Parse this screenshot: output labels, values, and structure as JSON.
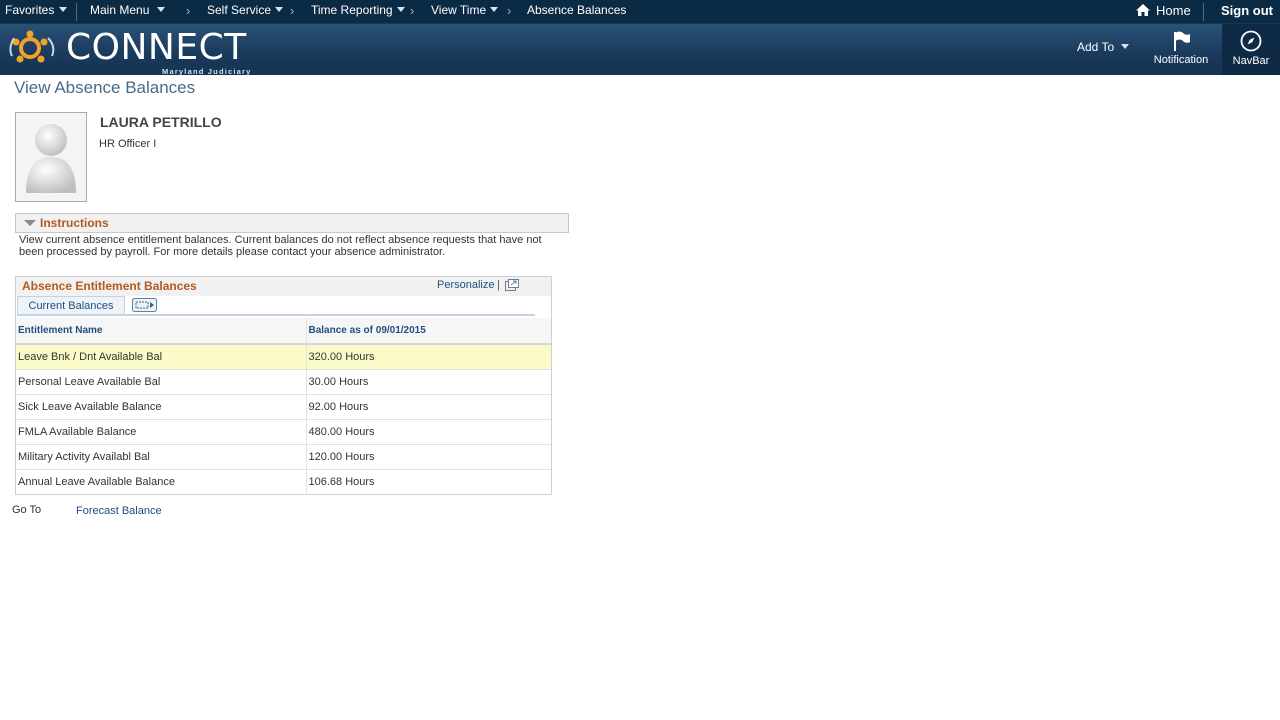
{
  "topnav": {
    "favorites": "Favorites",
    "main_menu": "Main Menu",
    "breadcrumbs": [
      "Self Service",
      "Time Reporting",
      "View Time",
      "Absence Balances"
    ],
    "home": "Home",
    "sign_out": "Sign out"
  },
  "banner": {
    "logo_text": "CONNECT",
    "logo_sub": "Maryland Judiciary",
    "add_to": "Add To",
    "notification": "Notification",
    "navbar": "NavBar"
  },
  "page": {
    "title": "View Absence Balances",
    "employee_name": "LAURA PETRILLO",
    "employee_title": "HR Officer I"
  },
  "instructions": {
    "label": "Instructions",
    "text": "View current absence entitlement balances. Current balances do not reflect absence requests that have not been processed by payroll. For more details please contact your absence administrator."
  },
  "grid": {
    "title": "Absence Entitlement Balances",
    "personalize": "Personalize",
    "pipe": "|",
    "tab_label": "Current Balances",
    "columns": [
      "Entitlement Name",
      "Balance as of 09/01/2015"
    ],
    "rows": [
      [
        "Leave Bnk / Dnt Available Bal",
        "320.00 Hours"
      ],
      [
        "Personal Leave Available Bal",
        "30.00 Hours"
      ],
      [
        "Sick Leave Available Balance",
        "92.00 Hours"
      ],
      [
        "FMLA Available Balance",
        "480.00 Hours"
      ],
      [
        "Military Activity Availabl Bal",
        "120.00 Hours"
      ],
      [
        "Annual Leave Available Balance",
        "106.68 Hours"
      ]
    ]
  },
  "footer": {
    "go_to": "Go To",
    "forecast": "Forecast Balance"
  },
  "colors": {
    "nav_bg": "#0b2a44",
    "banner_bg": "#1a3a5c",
    "section_title": "#b35a1f",
    "link": "#1f4f80",
    "highlight_row": "#fbfbc9"
  }
}
